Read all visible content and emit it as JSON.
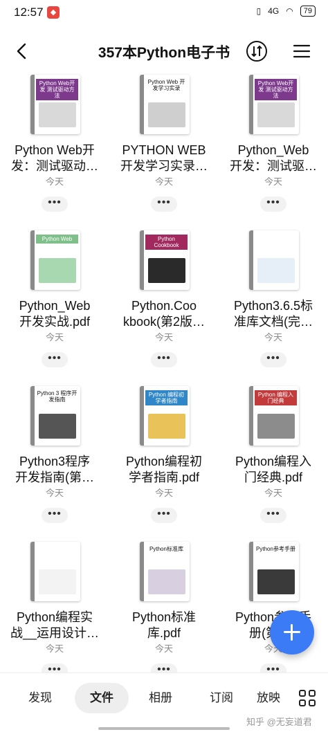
{
  "status": {
    "time": "12:57",
    "network": "4G",
    "battery": "79"
  },
  "header": {
    "title": "357本Python电子书"
  },
  "books": [
    {
      "name": "Python Web开\n发：测试驱动…",
      "date": "今天",
      "cover_text": "Python Web开发 测试驱动方法",
      "cover_color": "#7d3a8c",
      "art_color": "#d9d9d9"
    },
    {
      "name": "PYTHON WEB\n开发学习实录…",
      "date": "今天",
      "cover_text": "Python Web 开发学习实录",
      "cover_color": "#ffffff",
      "art_color": "#cfcfcf"
    },
    {
      "name": "Python_Web\n开发：测试驱…",
      "date": "今天",
      "cover_text": "Python Web开发 测试驱动方法",
      "cover_color": "#7d3a8c",
      "art_color": "#d9d9d9"
    },
    {
      "name": "Python_Web\n开发实战.pdf",
      "date": "今天",
      "cover_text": "Python Web",
      "cover_color": "#7fc08a",
      "art_color": "#a8d8b0"
    },
    {
      "name": "Python.Coo\nkbook(第2版…",
      "date": "今天",
      "cover_text": "Python Cookbook",
      "cover_color": "#a2295e",
      "art_color": "#2a2a2a"
    },
    {
      "name": "Python3.6.5标\n准库文档(完…",
      "date": "今天",
      "cover_text": "",
      "cover_color": "#ffffff",
      "art_color": "#e6eef7"
    },
    {
      "name": "Python3程序\n开发指南(第…",
      "date": "今天",
      "cover_text": "Python 3 程序开发指南",
      "cover_color": "#ffffff",
      "art_color": "#555555"
    },
    {
      "name": "Python编程初\n学者指南.pdf",
      "date": "今天",
      "cover_text": "Python 编程初学者指南",
      "cover_color": "#2f87c8",
      "art_color": "#e9c35a"
    },
    {
      "name": "Python编程入\n门经典.pdf",
      "date": "今天",
      "cover_text": "Python 编程入门经典",
      "cover_color": "#c23a3a",
      "art_color": "#8c8c8c"
    },
    {
      "name": "Python编程实\n战__运用设计…",
      "date": "今天",
      "cover_text": "",
      "cover_color": "#ffffff",
      "art_color": "#f3f3f3"
    },
    {
      "name": "Python标准\n库.pdf",
      "date": "今天",
      "cover_text": "Python标准库",
      "cover_color": "#ffffff",
      "art_color": "#d8cfe0"
    },
    {
      "name": "Python参考手\n册(第4…",
      "date": "今天",
      "cover_text": "Python参考手册",
      "cover_color": "#ffffff",
      "art_color": "#3a3a3a"
    }
  ],
  "more_label": "•••",
  "nav": {
    "discover": "发现",
    "files": "文件",
    "album": "相册",
    "subscribe": "订阅",
    "playlist": "放映"
  },
  "watermark": "知乎 @无妄道君"
}
